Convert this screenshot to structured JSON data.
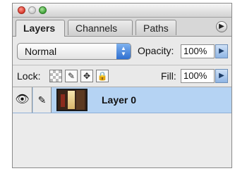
{
  "tabs": [
    "Layers",
    "Channels",
    "Paths"
  ],
  "panel_menu_icon": "play-triangle-icon",
  "blend": {
    "value": "Normal",
    "arrow_icon": "up-down-chevrons"
  },
  "opacity": {
    "label": "Opacity:",
    "value": "100%"
  },
  "lock": {
    "label": "Lock:",
    "icons": [
      "transparency-checker-icon",
      "brush-icon",
      "move-icon",
      "padlock-icon"
    ]
  },
  "fill": {
    "label": "Fill:",
    "value": "100%"
  },
  "layer": {
    "name": "Layer 0",
    "visibility_icon": "eye-icon",
    "link_icon": "brush-icon"
  },
  "colors": {
    "selected_row": "#b5d3f3",
    "stepper": "#8fb5e4"
  }
}
